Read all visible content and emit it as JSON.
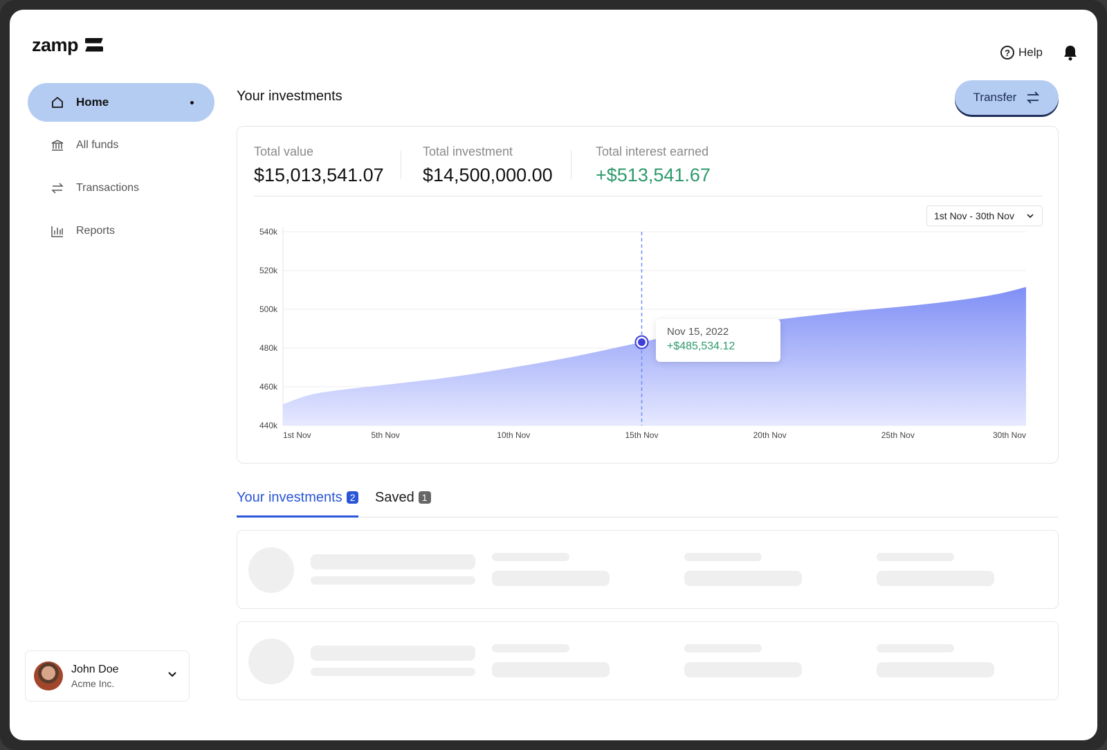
{
  "app": {
    "logo_text": "zamp"
  },
  "header": {
    "help_label": "Help"
  },
  "sidebar": {
    "items": [
      {
        "label": "Home",
        "icon": "home-icon",
        "active": true
      },
      {
        "label": "All funds",
        "icon": "bank-icon",
        "active": false
      },
      {
        "label": "Transactions",
        "icon": "arrows-icon",
        "active": false
      },
      {
        "label": "Reports",
        "icon": "bar-chart-icon",
        "active": false
      }
    ]
  },
  "user": {
    "name": "John Doe",
    "org": "Acme Inc."
  },
  "main": {
    "title": "Your investments",
    "transfer_label": "Transfer",
    "stats": [
      {
        "label": "Total value",
        "value": "$15,013,541.07"
      },
      {
        "label": "Total investment",
        "value": "$14,500,000.00"
      },
      {
        "label": "Total interest earned",
        "value": "+$513,541.67"
      }
    ],
    "date_range": "1st Nov - 30th Nov",
    "tooltip": {
      "date": "Nov 15, 2022",
      "value": "+$485,534.12"
    },
    "tabs": [
      {
        "label": "Your investments",
        "count": "2",
        "active": true
      },
      {
        "label": "Saved",
        "count": "1",
        "active": false
      }
    ]
  },
  "colors": {
    "accent": "#b5ccf2",
    "positive": "#2e9a6c",
    "area": "#7f90f5",
    "tab_active": "#2a55d6"
  },
  "chart_data": {
    "type": "area",
    "x": [
      "1st Nov",
      "2nd Nov",
      "3rd Nov",
      "4th Nov",
      "5th Nov",
      "6th Nov",
      "7th Nov",
      "8th Nov",
      "9th Nov",
      "10th Nov",
      "11th Nov",
      "12th Nov",
      "13th Nov",
      "14th Nov",
      "15th Nov",
      "16th Nov",
      "17th Nov",
      "18th Nov",
      "19th Nov",
      "20th Nov",
      "21st Nov",
      "22nd Nov",
      "23rd Nov",
      "24th Nov",
      "25th Nov",
      "26th Nov",
      "27th Nov",
      "28th Nov",
      "29th Nov",
      "30th Nov"
    ],
    "values": [
      451000,
      456000,
      458000,
      459500,
      461000,
      462500,
      464000,
      465800,
      467800,
      470000,
      472300,
      474700,
      477300,
      480200,
      483000,
      486000,
      488500,
      490800,
      492500,
      494200,
      495800,
      497300,
      498800,
      500000,
      501200,
      502500,
      504000,
      505800,
      508000,
      511500
    ],
    "xticks": [
      "1st Nov",
      "5th Nov",
      "10th Nov",
      "15th Nov",
      "20th Nov",
      "25th Nov",
      "30th Nov"
    ],
    "yticks": [
      "440k",
      "460k",
      "480k",
      "500k",
      "520k",
      "540k"
    ],
    "ylim": [
      440000,
      540000
    ],
    "highlight": {
      "x": "15th Nov"
    }
  }
}
